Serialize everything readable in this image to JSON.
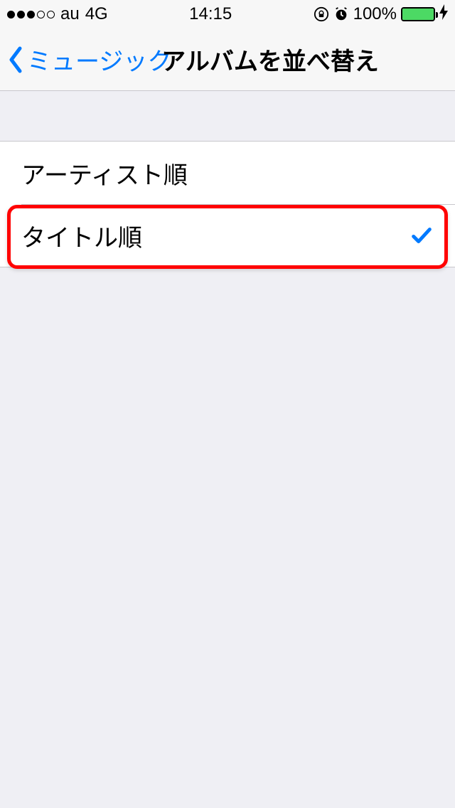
{
  "status": {
    "carrier": "au",
    "network": "4G",
    "time": "14:15",
    "battery_pct": "100%"
  },
  "nav": {
    "back_label": "ミュージック",
    "title": "アルバムを並べ替え"
  },
  "options": [
    {
      "label": "アーティスト順",
      "selected": false
    },
    {
      "label": "タイトル順",
      "selected": true
    }
  ]
}
